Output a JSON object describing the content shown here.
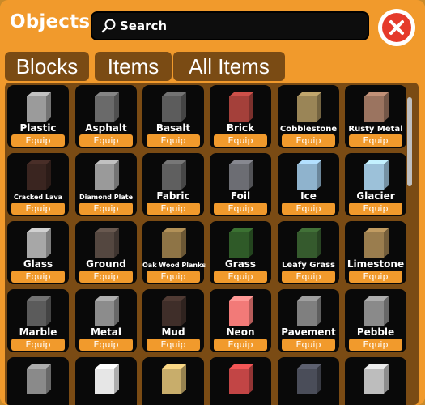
{
  "header": {
    "title": "Objects"
  },
  "search": {
    "placeholder": "Search"
  },
  "tabs": [
    {
      "label": "Blocks"
    },
    {
      "label": "Items"
    },
    {
      "label": "All Items"
    }
  ],
  "items": [
    {
      "name": "Plastic",
      "equip": "Equip",
      "color": "#9b9b9b"
    },
    {
      "name": "Asphalt",
      "equip": "Equip",
      "color": "#6a6a6a"
    },
    {
      "name": "Basalt",
      "equip": "Equip",
      "color": "#5c5c5c"
    },
    {
      "name": "Brick",
      "equip": "Equip",
      "color": "#a4403a"
    },
    {
      "name": "Cobblestone",
      "equip": "Equip",
      "color": "#9a8557"
    },
    {
      "name": "Rusty Metal",
      "equip": "Equip",
      "color": "#9b7460"
    },
    {
      "name": "Cracked Lava",
      "equip": "Equip",
      "color": "#3a2520"
    },
    {
      "name": "Diamond Plate",
      "equip": "Equip",
      "color": "#9a9a9a"
    },
    {
      "name": "Fabric",
      "equip": "Equip",
      "color": "#5f5f5f"
    },
    {
      "name": "Foil",
      "equip": "Equip",
      "color": "#6c6d73"
    },
    {
      "name": "Ice",
      "equip": "Equip",
      "color": "#8fb3cd"
    },
    {
      "name": "Glacier",
      "equip": "Equip",
      "color": "#9cc1d9"
    },
    {
      "name": "Glass",
      "equip": "Equip",
      "color": "#a7a7a7"
    },
    {
      "name": "Ground",
      "equip": "Equip",
      "color": "#544740"
    },
    {
      "name": "Oak Wood Planks",
      "equip": "Equip",
      "color": "#8e7446"
    },
    {
      "name": "Grass",
      "equip": "Equip",
      "color": "#2f5a28"
    },
    {
      "name": "Leafy Grass",
      "equip": "Equip",
      "color": "#355a2d"
    },
    {
      "name": "Limestone",
      "equip": "Equip",
      "color": "#9a7d4e"
    },
    {
      "name": "Marble",
      "equip": "Equip",
      "color": "#5b5b5b"
    },
    {
      "name": "Metal",
      "equip": "Equip",
      "color": "#8c8c8c"
    },
    {
      "name": "Mud",
      "equip": "Equip",
      "color": "#3f2e29"
    },
    {
      "name": "Neon",
      "equip": "Equip",
      "color": "#f27a78"
    },
    {
      "name": "Pavement",
      "equip": "Equip",
      "color": "#7f7f7f"
    },
    {
      "name": "Pebble",
      "equip": "Equip",
      "color": "#8a8a8a"
    },
    {
      "name": "",
      "equip": "",
      "color": "#8a8a8a"
    },
    {
      "name": "",
      "equip": "",
      "color": "#e6e6e6"
    },
    {
      "name": "",
      "equip": "",
      "color": "#c8ad6b"
    },
    {
      "name": "",
      "equip": "",
      "color": "#c24545"
    },
    {
      "name": "",
      "equip": "",
      "color": "#4a4d59"
    },
    {
      "name": "",
      "equip": "",
      "color": "#bdbdbd"
    }
  ]
}
